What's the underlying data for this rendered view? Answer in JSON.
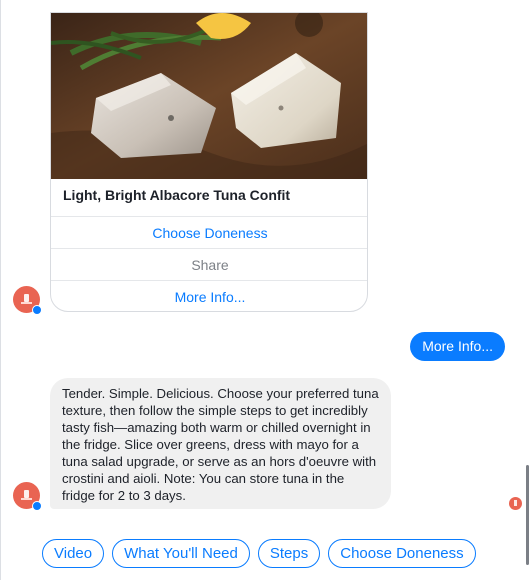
{
  "card": {
    "title": "Light, Bright Albacore Tuna Confit",
    "buttons": [
      {
        "label": "Choose Doneness"
      },
      {
        "label": "Share"
      },
      {
        "label": "More Info..."
      }
    ]
  },
  "messages": {
    "outgoing": "More Info...",
    "incoming": "Tender. Simple. Delicious. Choose your preferred tuna texture, then follow the simple steps to get incredibly tasty fish—amazing both warm or chilled overnight in the fridge. Slice over greens, dress with mayo for a tuna salad upgrade, or serve as an hors d'oeuvre with crostini and aioli. Note: You can store tuna in the fridge for 2 to 3 days."
  },
  "quick_replies": [
    {
      "label": "Video"
    },
    {
      "label": "What You'll Need"
    },
    {
      "label": "Steps"
    },
    {
      "label": "Choose Doneness"
    }
  ],
  "colors": {
    "accent": "#0a7cff",
    "avatar": "#e96452",
    "incoming_bubble": "#f0f0f0"
  },
  "icons": {
    "avatar": "chefsteps-logo-icon",
    "messenger_badge": "messenger-icon",
    "seen_indicator": "seen-avatar-icon"
  }
}
